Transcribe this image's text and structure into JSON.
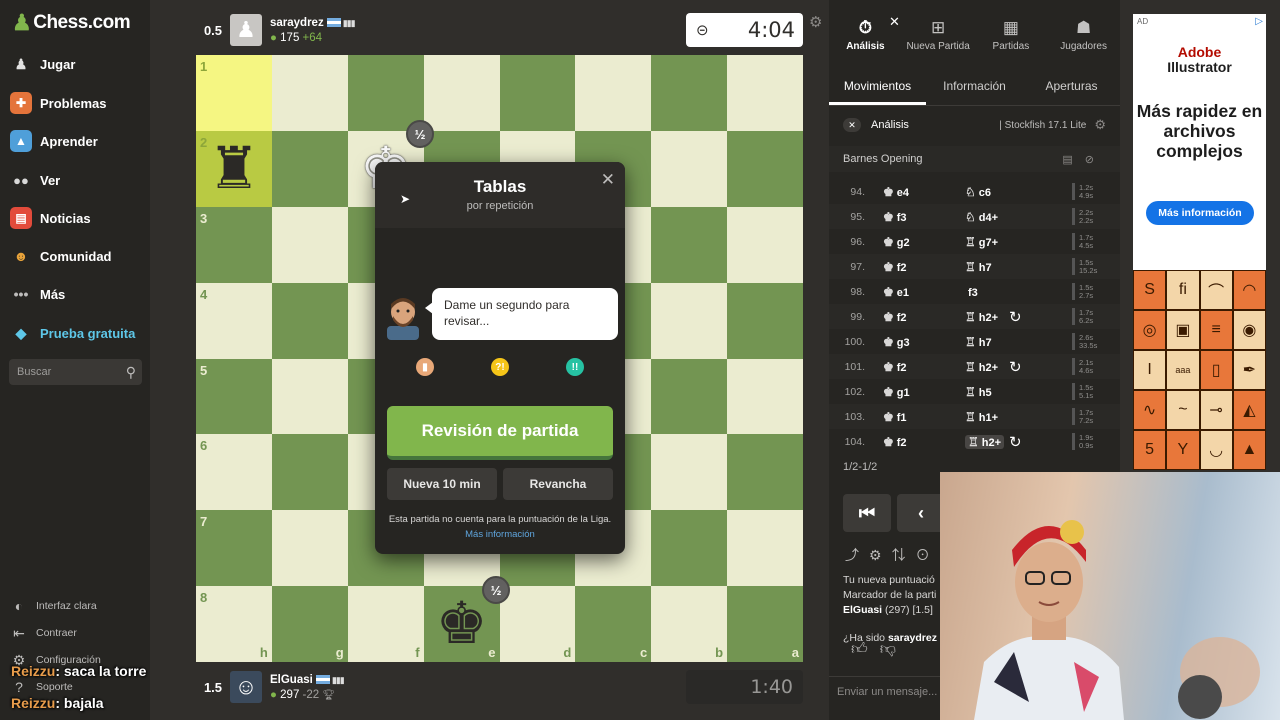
{
  "sidebar": {
    "logo": "Chess.com",
    "items": [
      {
        "label": "Jugar",
        "icon": "hand-pawn-icon",
        "color": "#e2e2e2"
      },
      {
        "label": "Problemas",
        "icon": "puzzle-icon",
        "color": "#e4743b"
      },
      {
        "label": "Aprender",
        "icon": "graduation-icon",
        "color": "#4f9fd9"
      },
      {
        "label": "Ver",
        "icon": "binoculars-icon",
        "color": "#d8d8d8"
      },
      {
        "label": "Noticias",
        "icon": "newspaper-icon",
        "color": "#e24b3b"
      },
      {
        "label": "Comunidad",
        "icon": "community-icon",
        "color": "#e8a33a"
      },
      {
        "label": "Más",
        "icon": "more-dots-icon",
        "color": "#bdbcbb"
      },
      {
        "label": "Prueba gratuita",
        "icon": "diamond-icon",
        "color": "#5ec7e8"
      }
    ],
    "search_placeholder": "Buscar",
    "bottom": {
      "theme": "Interfaz clara",
      "collapse": "Contraer",
      "settings": "Configuración",
      "support": "Soporte"
    }
  },
  "stream_chat": [
    {
      "user": "Reizzu",
      "text": ": saca la torre"
    },
    {
      "user": "Reizzu",
      "text": ": bajala"
    }
  ],
  "top_player": {
    "score": "0.5",
    "name": "saraydrez",
    "rating": "175",
    "delta": "+64",
    "clock": "4:04"
  },
  "bottom_player": {
    "score": "1.5",
    "name": "ElGuasi",
    "rating": "297",
    "delta": "-22",
    "clock": "1:40"
  },
  "board": {
    "ranks": [
      "1",
      "2",
      "3",
      "4",
      "5",
      "6",
      "7",
      "8"
    ],
    "files": [
      "h",
      "g",
      "f",
      "e",
      "d",
      "c",
      "b",
      "a"
    ],
    "badge": "½",
    "colors": {
      "light": "#ebecd0",
      "dark": "#739552",
      "highlight": "#f5f682"
    }
  },
  "modal": {
    "title": "Tablas",
    "subtitle": "por repetición",
    "bubble": "Dame un segundo para revisar...",
    "review_button": "Revisión de partida",
    "new_game_button": "Nueva 10 min",
    "rematch_button": "Revancha",
    "note": "Esta partida no cuenta para la puntuación de la Liga.",
    "link": "Más información"
  },
  "right_panel": {
    "tabs": [
      {
        "label": "Análisis",
        "icon": "stopwatch-icon"
      },
      {
        "label": "Nueva Partida",
        "icon": "plus-square-icon"
      },
      {
        "label": "Partidas",
        "icon": "board-icon"
      },
      {
        "label": "Jugadores",
        "icon": "players-icon"
      }
    ],
    "subtabs": [
      "Movimientos",
      "Información",
      "Aperturas"
    ],
    "analysis_label": "Análisis",
    "engine": "Stockfish 17.1 Lite",
    "opening": "Barnes Opening",
    "moves": [
      {
        "n": "94.",
        "w": "e4",
        "b": "c6",
        "bp": "♘",
        "t1": "1.2s",
        "t2": "4.9s"
      },
      {
        "n": "95.",
        "w": "f3",
        "b": "d4+",
        "bp": "♘",
        "t1": "2.2s",
        "t2": "2.2s"
      },
      {
        "n": "96.",
        "w": "g2",
        "b": "g7+",
        "bp": "♖",
        "t1": "1.7s",
        "t2": "4.5s"
      },
      {
        "n": "97.",
        "w": "f2",
        "b": "h7",
        "bp": "♖",
        "t1": "1.5s",
        "t2": "15.2s"
      },
      {
        "n": "98.",
        "w": "e1",
        "b": "f3",
        "bp": "",
        "t1": "1.5s",
        "t2": "2.7s"
      },
      {
        "n": "99.",
        "w": "f2",
        "b": "h2+",
        "bp": "♖",
        "t1": "1.7s",
        "t2": "6.2s"
      },
      {
        "n": "100.",
        "w": "g3",
        "b": "h7",
        "bp": "♖",
        "t1": "2.6s",
        "t2": "33.5s"
      },
      {
        "n": "101.",
        "w": "f2",
        "b": "h2+",
        "bp": "♖",
        "t1": "2.1s",
        "t2": "4.6s"
      },
      {
        "n": "102.",
        "w": "g1",
        "b": "h5",
        "bp": "♖",
        "t1": "1.5s",
        "t2": "5.1s"
      },
      {
        "n": "103.",
        "w": "f1",
        "b": "h1+",
        "bp": "♖",
        "t1": "1.7s",
        "t2": "7.2s"
      },
      {
        "n": "104.",
        "w": "f2",
        "b": "h2+",
        "bp": "♖",
        "t1": "1.9s",
        "t2": "0.9s"
      }
    ],
    "result": "1/2-1/2",
    "chat": {
      "line1": "Tu nueva puntuació",
      "line2": "Marcador de la parti",
      "line3_name": "ElGuasi",
      "line3_rest": " (297) [1.5]",
      "line4_pre": "¿Ha sido ",
      "line4_name": "saraydrez"
    },
    "chat_placeholder": "Enviar un mensaje..."
  },
  "ad": {
    "tag": "AD",
    "brand_line1": "Adobe",
    "brand_line2": "Illustrator",
    "headline": "Más rapidez en archivos complejos",
    "button": "Más información",
    "accent": "#1473e6"
  }
}
